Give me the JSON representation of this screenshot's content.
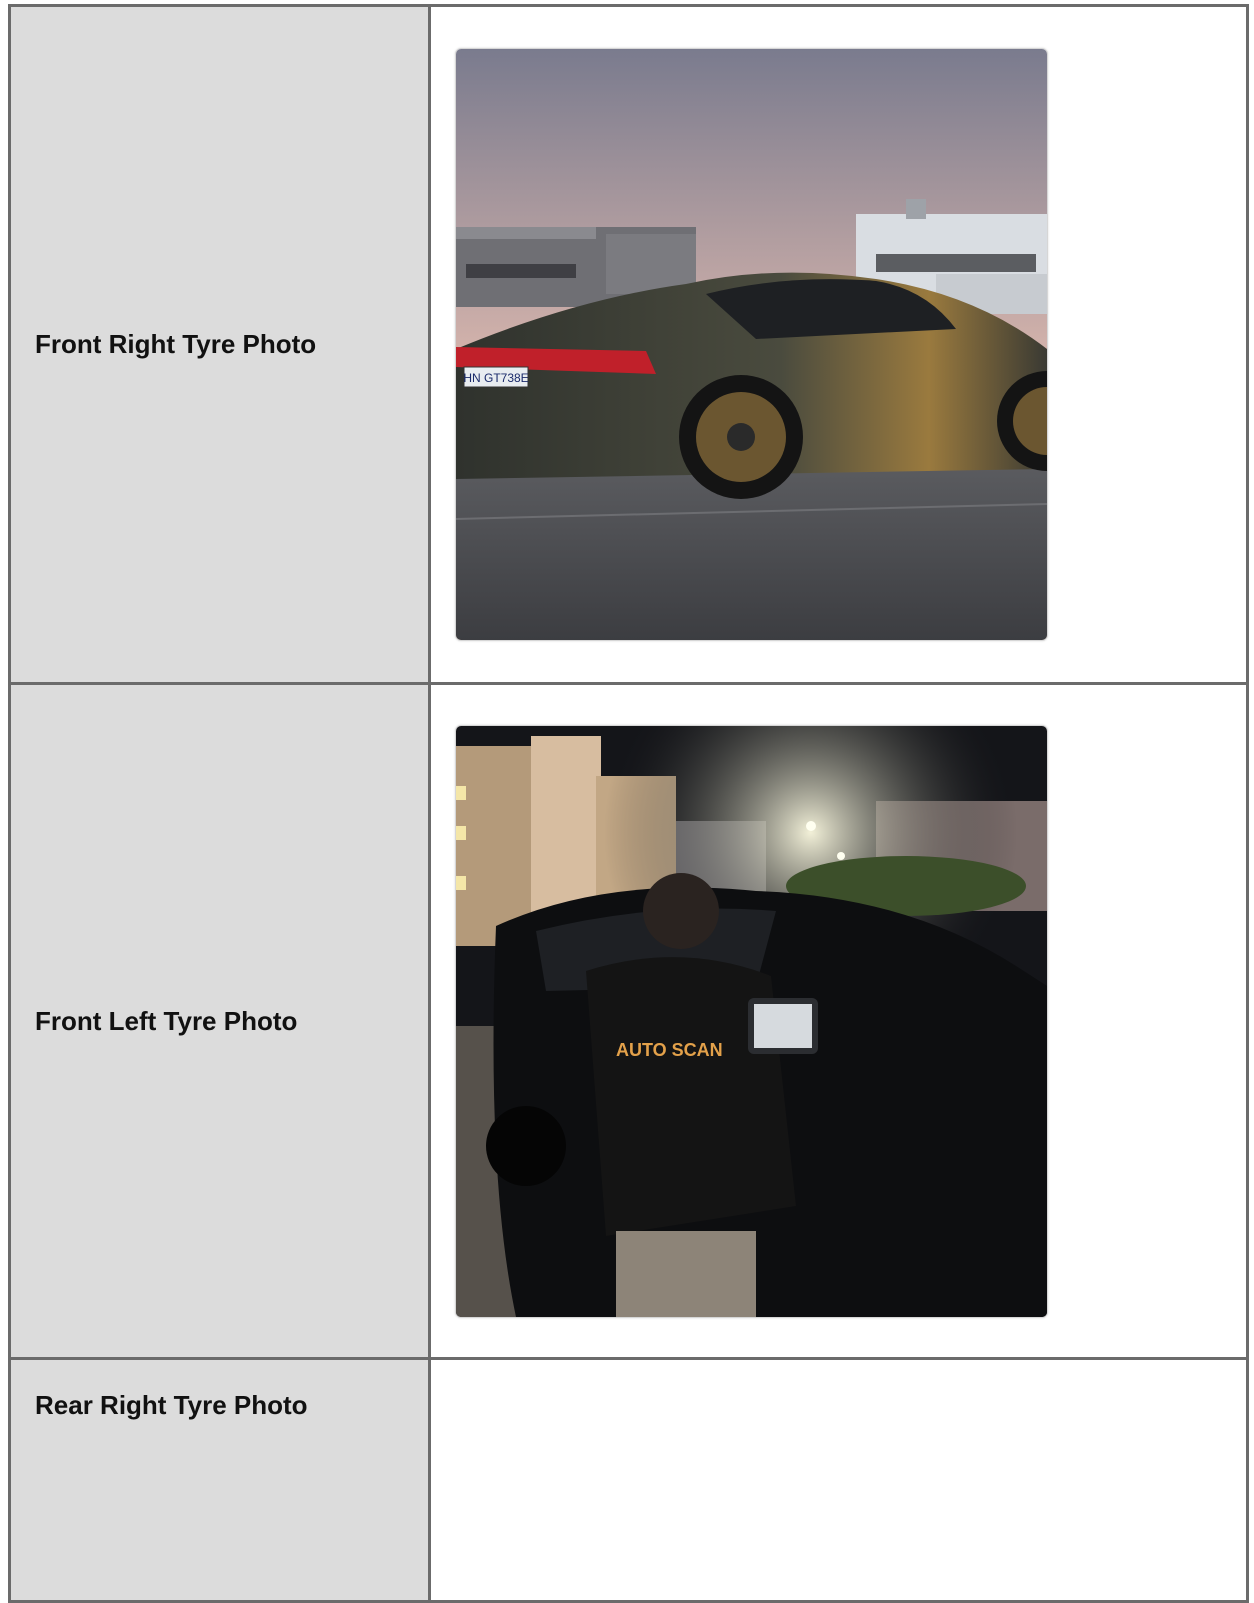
{
  "rows": [
    {
      "label": "Front Right Tyre Photo",
      "photo": "car-rear-quarter-photo"
    },
    {
      "label": "Front Left Tyre Photo",
      "photo": "technician-inspecting-car-photo"
    },
    {
      "label": "Rear Right Tyre Photo",
      "photo": ""
    }
  ],
  "photos": {
    "plate": "HN GT738E",
    "shirt_logo": "AUTO SCAN"
  }
}
